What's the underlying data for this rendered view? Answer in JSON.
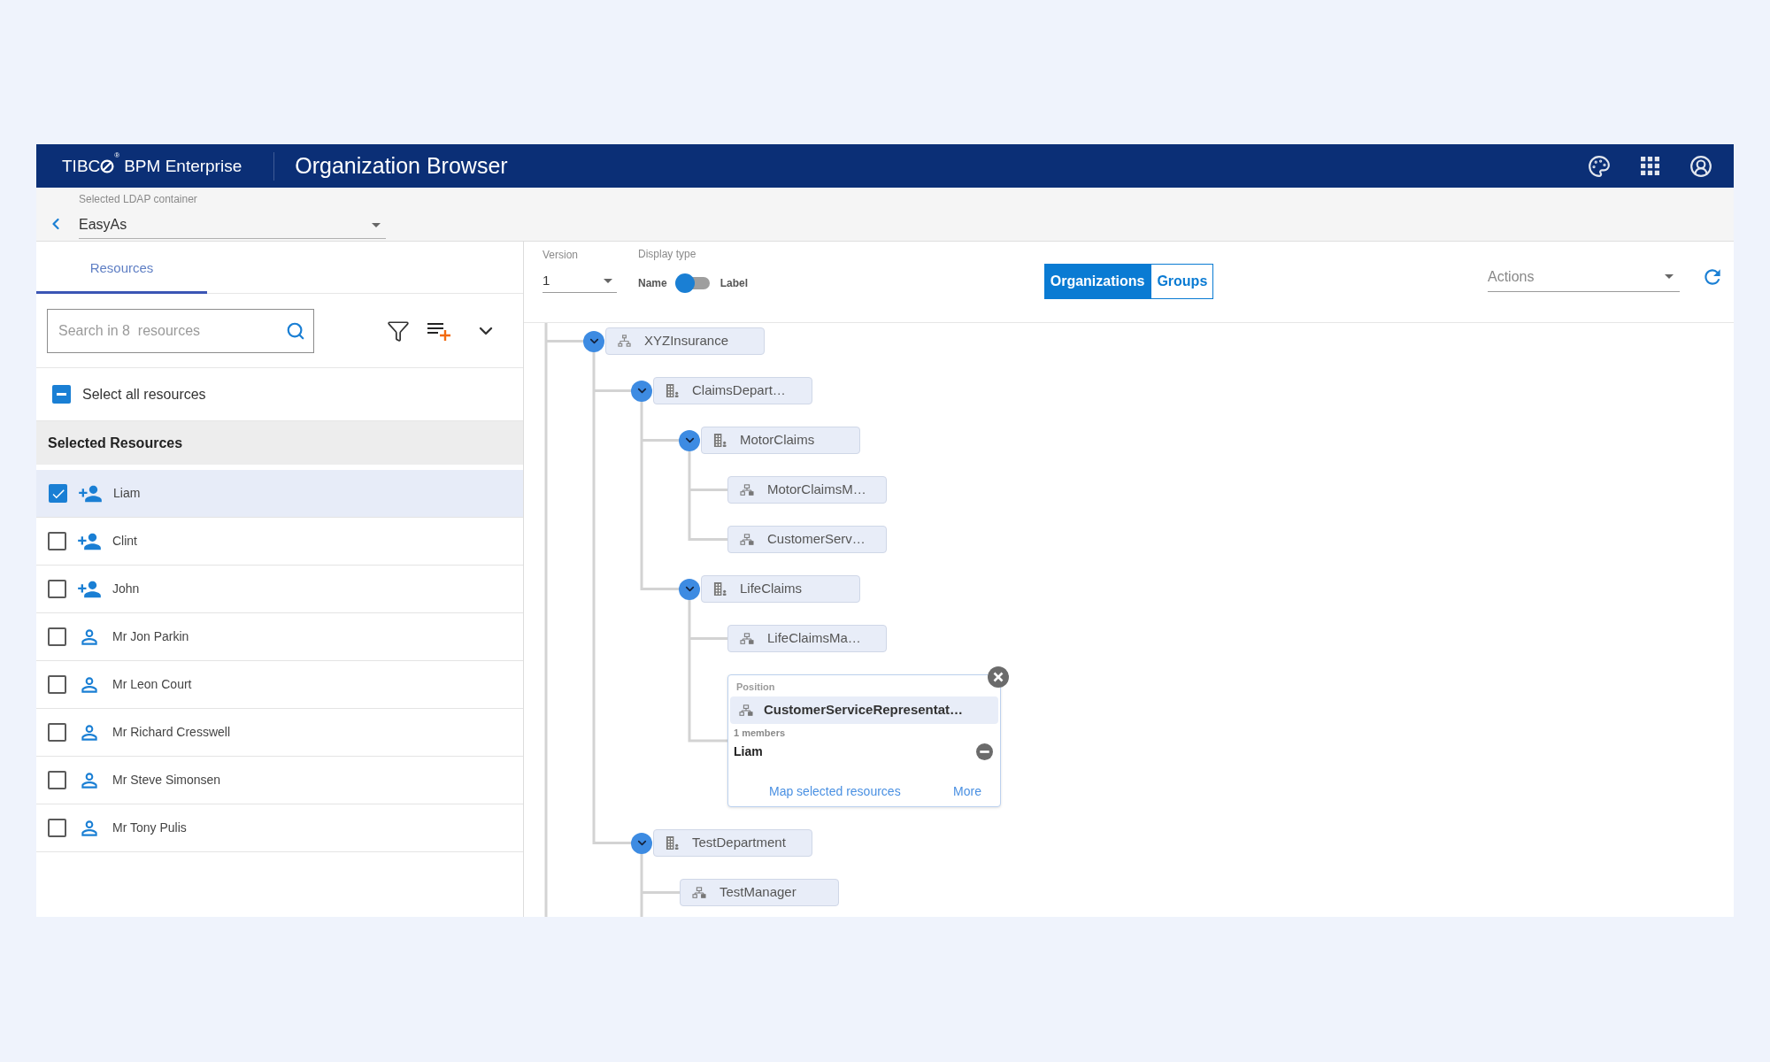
{
  "header": {
    "brand": {
      "prefix": "TIBC",
      "mark": "®",
      "product": "BPM Enterprise"
    },
    "title": "Organization Browser"
  },
  "container_bar": {
    "label": "Selected LDAP container",
    "value": "EasyAs"
  },
  "resources_panel": {
    "tabs": [
      {
        "label": "Resources",
        "selected": true
      }
    ],
    "search": {
      "placeholder": "Search in 8  resources"
    },
    "select_all": {
      "label": "Select all resources",
      "indeterminate": true
    },
    "section_title": "Selected Resources",
    "resources": [
      {
        "name": "Liam",
        "kind": "person-add",
        "checked": true,
        "selected": true
      },
      {
        "name": "Clint",
        "kind": "person-add",
        "checked": false,
        "selected": false
      },
      {
        "name": "John",
        "kind": "person-add",
        "checked": false,
        "selected": false
      },
      {
        "name": "Mr Jon Parkin",
        "kind": "person",
        "checked": false,
        "selected": false
      },
      {
        "name": "Mr Leon Court",
        "kind": "person",
        "checked": false,
        "selected": false
      },
      {
        "name": "Mr Richard Cresswell",
        "kind": "person",
        "checked": false,
        "selected": false
      },
      {
        "name": "Mr Steve Simonsen",
        "kind": "person",
        "checked": false,
        "selected": false
      },
      {
        "name": "Mr Tony Pulis",
        "kind": "person",
        "checked": false,
        "selected": false
      }
    ]
  },
  "toolbar": {
    "version": {
      "label": "Version",
      "value": "1"
    },
    "display_type": {
      "label": "Display type",
      "left": "Name",
      "right": "Label",
      "on": false
    },
    "view_tabs": [
      {
        "label": "Organizations",
        "selected": true
      },
      {
        "label": "Groups",
        "selected": false
      }
    ],
    "actions": {
      "label": "Actions"
    }
  },
  "tree": {
    "nodes": [
      {
        "kind": "organization",
        "name": "XYZInsurance",
        "expanded": true,
        "more_below": false,
        "children": [
          {
            "kind": "org_unit",
            "name": "ClaimsDepart…",
            "expanded": true,
            "more_below": false,
            "children": [
              {
                "kind": "org_unit",
                "name": "MotorClaims",
                "expanded": true,
                "more_below": false,
                "children": [
                  {
                    "kind": "position",
                    "name": "MotorClaimsM…"
                  },
                  {
                    "kind": "position",
                    "name": "CustomerServ…"
                  }
                ]
              },
              {
                "kind": "org_unit",
                "name": "LifeClaims",
                "expanded": true,
                "more_below": false,
                "children": [
                  {
                    "kind": "position",
                    "name": "LifeClaimsMa…"
                  },
                  {
                    "kind": "position_card",
                    "type_label": "Position",
                    "name": "CustomerServiceRepresentat…",
                    "member_count": "1 members",
                    "members": [
                      {
                        "name": "Liam"
                      }
                    ],
                    "links": [
                      "Map selected resources",
                      "More"
                    ]
                  }
                ]
              }
            ]
          },
          {
            "kind": "org_unit",
            "name": "TestDepartment",
            "expanded": true,
            "more_below": true,
            "children": [
              {
                "kind": "position",
                "name": "TestManager"
              }
            ]
          }
        ]
      }
    ]
  }
}
